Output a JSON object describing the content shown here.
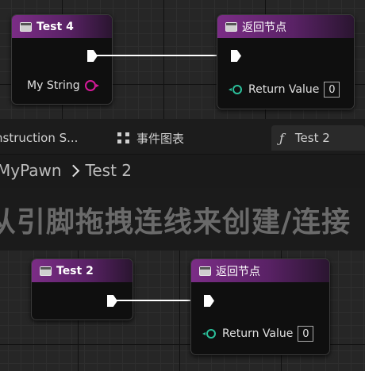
{
  "top_graph": {
    "function_node": {
      "title": "Test 4",
      "param_label": "My String"
    },
    "return_node": {
      "title": "返回节点",
      "return_label": "Return Value",
      "return_value": "0"
    }
  },
  "tabs": [
    {
      "label": "nstruction S..."
    },
    {
      "label": "事件图表"
    },
    {
      "label": "Test 2"
    }
  ],
  "breadcrumb": {
    "parent": "MyPawn",
    "current": "Test 2"
  },
  "banner": {
    "text": "从引脚拖拽连线来创建/连接"
  },
  "bottom_graph": {
    "function_node": {
      "title": "Test 2"
    },
    "return_node": {
      "title": "返回节点",
      "return_label": "Return Value",
      "return_value": "0"
    }
  },
  "colors": {
    "header_purple": "#7b2d86",
    "string_pin": "#d61a9b",
    "return_pin": "#2bbf9a",
    "exec": "#ffffff"
  }
}
